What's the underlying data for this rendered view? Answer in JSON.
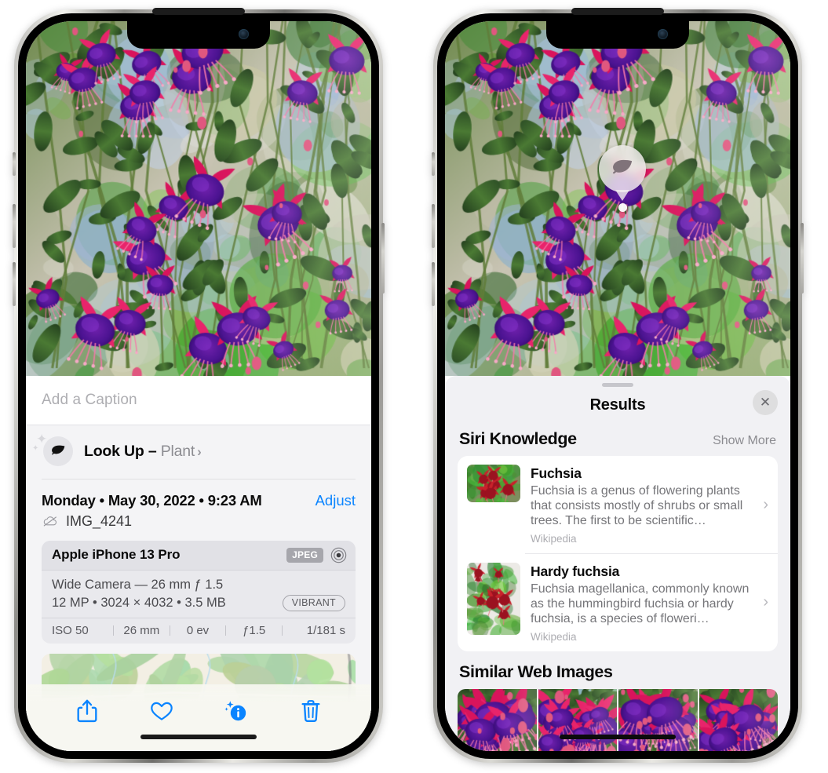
{
  "left_phone": {
    "caption": {
      "placeholder": "Add a Caption",
      "value": ""
    },
    "lookup": {
      "label": "Look Up",
      "dash": "–",
      "subject": "Plant",
      "chevron": "›",
      "icon": "leaf-icon"
    },
    "info": {
      "date": "Monday • May 30, 2022 • 9:23 AM",
      "adjust": "Adjust",
      "filename": "IMG_4241",
      "cloud_icon": "icloud-slash-icon"
    },
    "camera": {
      "model": "Apple iPhone 13 Pro",
      "format_badge": "JPEG",
      "raw_icon": "raw-target-icon",
      "lens": "Wide Camera — 26 mm ƒ 1.5",
      "specs": "12 MP • 3024 × 4032 • 3.5 MB",
      "style_badge": "VIBRANT",
      "exif": [
        "ISO 50",
        "26 mm",
        "0 ev",
        "ƒ1.5",
        "1/181 s"
      ]
    },
    "toolbar": [
      {
        "name": "share-icon",
        "label": "Share"
      },
      {
        "name": "heart-icon",
        "label": "Favorite"
      },
      {
        "name": "info-sparkle-icon",
        "label": "Info"
      },
      {
        "name": "trash-icon",
        "label": "Delete"
      }
    ]
  },
  "right_phone": {
    "visual_lookup_badge": {
      "icon": "leaf-icon"
    },
    "results": {
      "title": "Results",
      "close_label": "✕",
      "sections": [
        {
          "title": "Siri Knowledge",
          "action": "Show More",
          "items": [
            {
              "name": "Fuchsia",
              "description": "Fuchsia is a genus of flowering plants that consists mostly of shrubs or small trees. The first to be scientific…",
              "source": "Wikipedia",
              "chevron": "›"
            },
            {
              "name": "Hardy fuchsia",
              "description": "Fuchsia magellanica, commonly known as the hummingbird fuchsia or hardy fuchsia, is a species of floweri…",
              "source": "Wikipedia",
              "chevron": "›"
            }
          ]
        },
        {
          "title": "Similar Web Images",
          "action": "",
          "items": []
        }
      ]
    }
  },
  "colors": {
    "accent_blue": "#0a84ff",
    "sheet_gray": "#f1f1f4",
    "card_white": "#ffffff",
    "secondary_text": "#8b8b90"
  }
}
